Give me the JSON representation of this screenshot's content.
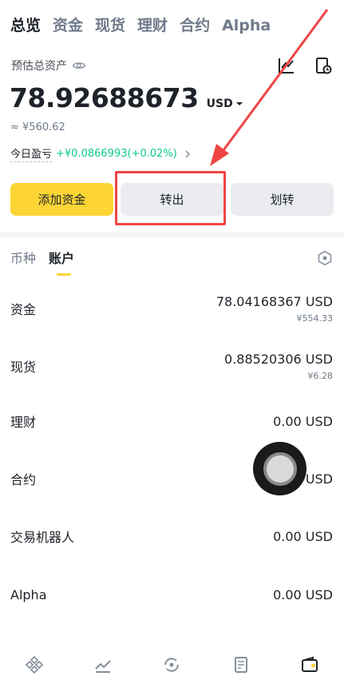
{
  "top_tabs": [
    "总览",
    "资金",
    "现货",
    "理财",
    "合约",
    "Alpha"
  ],
  "header": {
    "asset_label": "预估总资产",
    "balance": "78.92688673",
    "currency": "USD",
    "approx": "≈ ¥560.62",
    "pnl_label": "今日盈亏",
    "pnl_value": "+¥0.0866993(+0.02%)"
  },
  "buttons": {
    "add_funds": "添加资金",
    "withdraw": "转出",
    "transfer": "划转"
  },
  "sub_tabs": [
    "币种",
    "账户"
  ],
  "accounts": [
    {
      "name": "资金",
      "amount": "78.04168367 USD",
      "sub": "¥554.33"
    },
    {
      "name": "现货",
      "amount": "0.88520306 USD",
      "sub": "¥6.28"
    },
    {
      "name": "理财",
      "amount": "0.00 USD",
      "sub": ""
    },
    {
      "name": "合约",
      "amount": "USD",
      "sub": ""
    },
    {
      "name": "交易机器人",
      "amount": "0.00 USD",
      "sub": ""
    },
    {
      "name": "Alpha",
      "amount": "0.00 USD",
      "sub": ""
    }
  ],
  "colors": {
    "accent": "#fcd535",
    "positive": "#0ecb81",
    "annotation": "#ef4444"
  },
  "icons": [
    "eye-icon",
    "chart-icon",
    "history-icon",
    "hexagon-settings-icon",
    "home-icon",
    "markets-icon",
    "trade-icon",
    "futures-icon",
    "wallet-icon"
  ]
}
